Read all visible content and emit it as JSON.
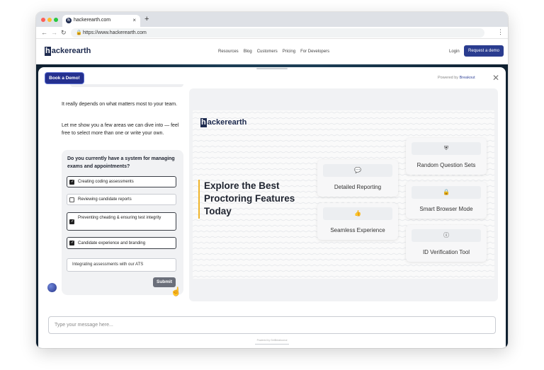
{
  "browser": {
    "tab_title": "hackerearth.com",
    "tab_close": "×",
    "new_tab": "+",
    "url": "https://www.hackerearth.com",
    "back_icon": "←",
    "forward_icon": "→",
    "reload_icon": "↻",
    "lock_icon": "🔒",
    "menu_icon": "⋮"
  },
  "site": {
    "logo_letter": "h",
    "logo_rest": "ackerearth",
    "nav": [
      "Resources",
      "Blog",
      "Customers",
      "Pricing",
      "For Developers"
    ],
    "login": "Login",
    "cta": "Request a demo"
  },
  "modal": {
    "book_demo": "Book a Demo!",
    "powered_prefix": "Powered by",
    "powered_brand": "Breakout",
    "close_icon": "✕"
  },
  "chat": {
    "message1": "It really depends on what matters most to your team.",
    "message2": "Let me show you a few areas we can dive into — feel free to select more than one or write your own.",
    "question": "Do you currently have a system for managing exams and appointments?",
    "options": [
      {
        "label": "Creating coding assessments",
        "checked": true
      },
      {
        "label": "Reviewing candidate reports",
        "checked": false
      },
      {
        "label": "Preventing cheating & ensuring test integrity",
        "checked": true
      },
      {
        "label": "Candidate experience and branding",
        "checked": true
      }
    ],
    "write_in": "Integrating assessments with our ATS",
    "submit": "Submit",
    "input_placeholder": "Type your message here...",
    "footer_note": "Powered by GetBreakout.ai"
  },
  "preview": {
    "logo_letter": "h",
    "logo_rest": "ackerearth",
    "headline": "Explore the Best Proctoring Features Today",
    "features": [
      {
        "label": "Random Question Sets",
        "icon": "shield-icon",
        "glyph": "⛨"
      },
      {
        "label": "Detailed Reporting",
        "icon": "chat-icon",
        "glyph": "💬"
      },
      {
        "label": "Smart Browser Mode",
        "icon": "lock-icon",
        "glyph": "🔒"
      },
      {
        "label": "Seamless Experience",
        "icon": "thumbs-up-icon",
        "glyph": "👍"
      },
      {
        "label": "ID Verification Tool",
        "icon": "info-icon",
        "glyph": "ⓘ"
      }
    ]
  },
  "colors": {
    "brand_navy": "#1e2b4f",
    "primary_button": "#24308f",
    "accent_yellow": "#f0b429",
    "submit_gray": "#6b6f7a"
  }
}
